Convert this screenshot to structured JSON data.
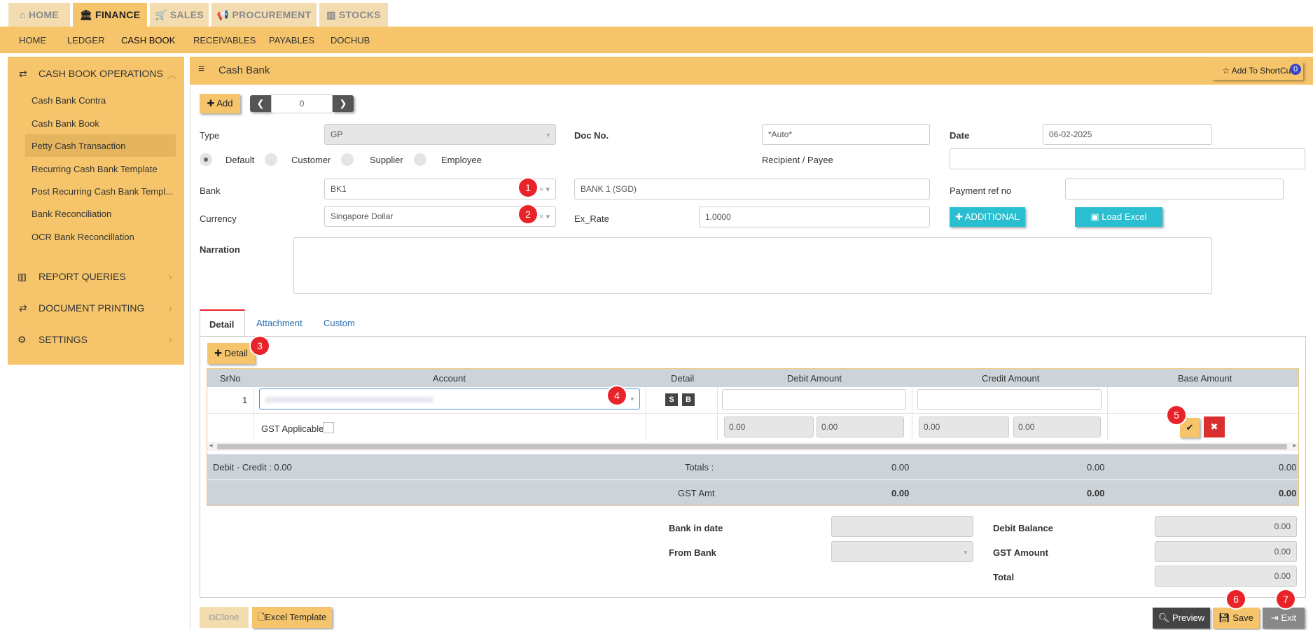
{
  "module_tabs": [
    {
      "label": "HOME",
      "icon": "home-icon"
    },
    {
      "label": "FINANCE",
      "icon": "bank-icon",
      "active": true
    },
    {
      "label": "SALES",
      "icon": "cart-icon"
    },
    {
      "label": "PROCUREMENT",
      "icon": "megaphone-icon"
    },
    {
      "label": "STOCKS",
      "icon": "bar-chart-icon"
    }
  ],
  "sub_nav": [
    "HOME",
    "LEDGER",
    "CASH BOOK",
    "RECEIVABLES",
    "PAYABLES",
    "DOCHUB"
  ],
  "sidebar": {
    "section_main": "CASH BOOK OPERATIONS",
    "items": [
      "Cash Bank Contra",
      "Cash Bank Book",
      "Petty Cash Transaction",
      "Recurring Cash Bank Template",
      "Post Recurring Cash Bank Templ...",
      "Bank Reconciliation",
      "OCR Bank Reconcillation"
    ],
    "sections": [
      "REPORT QUERIES",
      "DOCUMENT PRINTING",
      "SETTINGS"
    ]
  },
  "header": {
    "title": "Cash Bank",
    "shortcut_label": "Add To ShortCut",
    "shortcut_count": "0"
  },
  "toolbar": {
    "add_label": "Add",
    "record_no": "0"
  },
  "form": {
    "type_label": "Type",
    "type_value": "GP",
    "docno_label": "Doc No.",
    "docno_value": "*Auto*",
    "date_label": "Date",
    "date_value": "06-02-2025",
    "radios": [
      "Default",
      "Customer",
      "Supplier",
      "Employee"
    ],
    "recipient_label": "Recipient / Payee",
    "bank_label": "Bank",
    "bank_value": "BK1",
    "bank_name": "BANK 1 (SGD)",
    "payref_label": "Payment ref no",
    "currency_label": "Currency",
    "currency_value": "Singapore Dollar",
    "exrate_label": "Ex_Rate",
    "exrate_value": "1.0000",
    "additional_label": "ADDITIONAL",
    "load_excel_label": "Load Excel",
    "narration_label": "Narration"
  },
  "tabs": [
    "Detail",
    "Attachment",
    "Custom"
  ],
  "detail": {
    "add_detail_label": "Detail",
    "columns": [
      "SrNo",
      "Account",
      "Detail",
      "Debit Amount",
      "Credit Amount",
      "Base Amount"
    ],
    "row_no": "1",
    "s_btn": "S",
    "b_btn": "B",
    "gst_label": "GST Applicable",
    "gst_values": [
      "0.00",
      "0.00",
      "0.00",
      "0.00"
    ],
    "debit_credit": "Debit - Credit : 0.00",
    "totals_label": "Totals :",
    "totals": [
      "0.00",
      "0.00",
      "0.00"
    ],
    "gst_amt_label": "GST Amt",
    "gst_amt": [
      "0.00",
      "0.00",
      "0.00"
    ]
  },
  "summary": {
    "bank_in_date_label": "Bank in date",
    "from_bank_label": "From Bank",
    "debit_balance_label": "Debit Balance",
    "debit_balance": "0.00",
    "gst_amount_label": "GST Amount",
    "gst_amount": "0.00",
    "total_label": "Total",
    "total": "0.00"
  },
  "footer": {
    "clone_label": "Clone",
    "excel_label": "Excel Template",
    "preview_label": "Preview",
    "save_label": "Save",
    "exit_label": "Exit"
  },
  "badges": [
    "1",
    "2",
    "3",
    "4",
    "5",
    "6",
    "7"
  ],
  "colors": {
    "accent": "#f6c56b",
    "teal": "#29bfd0",
    "badge": "#e8232a"
  }
}
